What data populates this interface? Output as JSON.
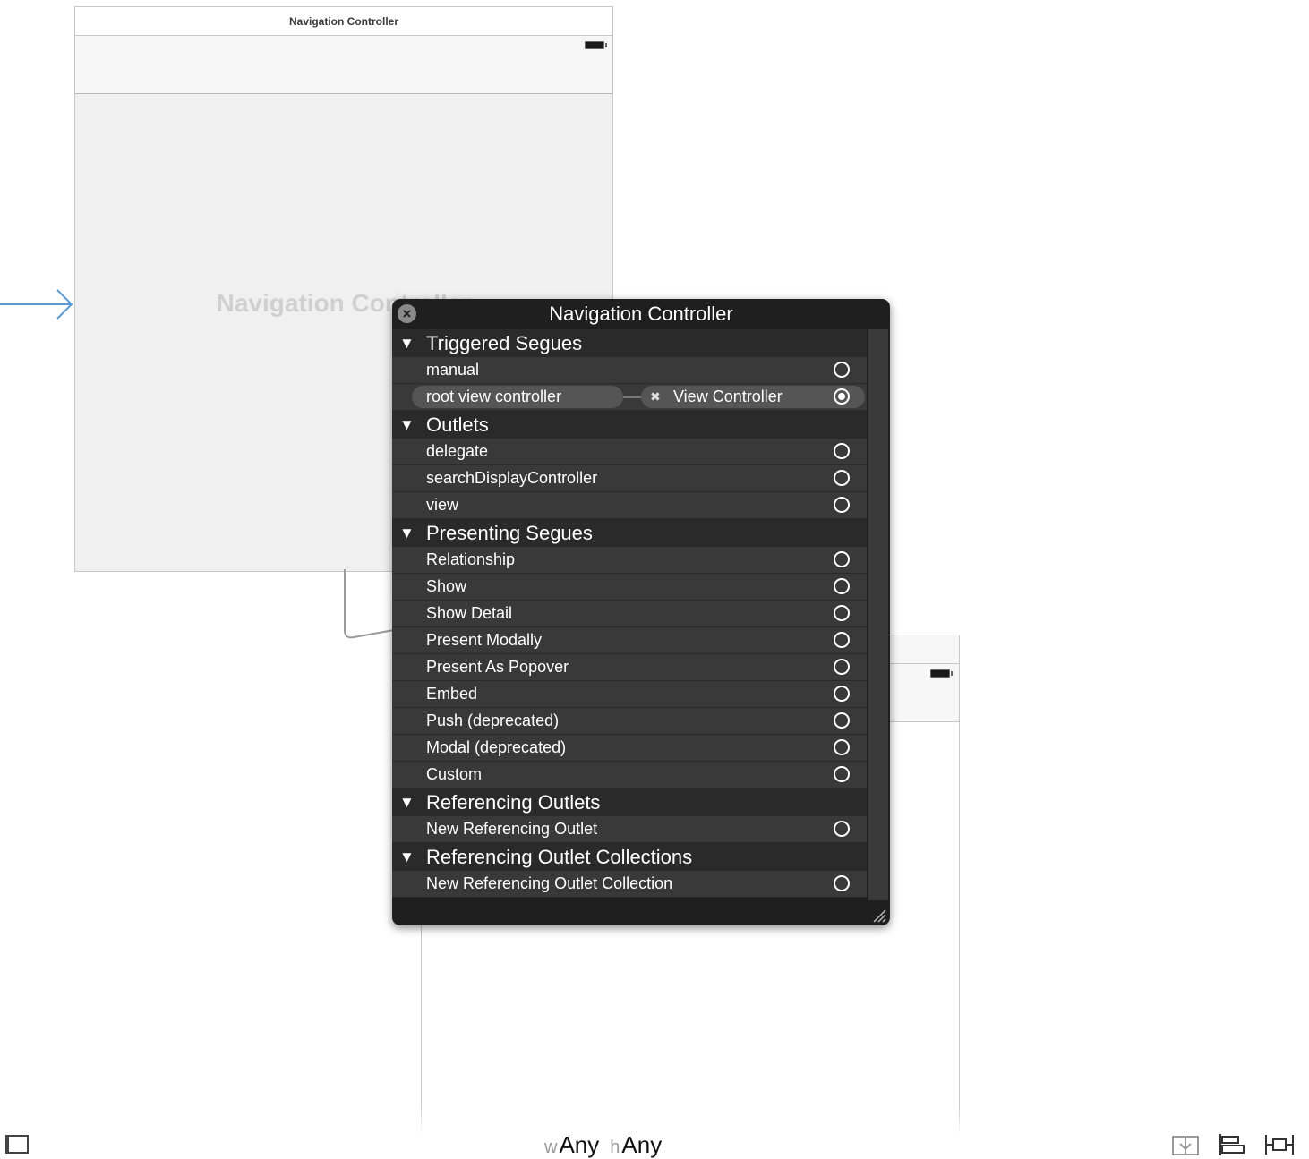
{
  "canvas": {
    "nav_scene": {
      "title": "Navigation Controller",
      "placeholder": "Navigation Controller"
    }
  },
  "hud": {
    "title": "Navigation Controller",
    "close_icon": "close-icon",
    "sections": [
      {
        "label": "Triggered Segues",
        "rows": [
          {
            "label": "manual"
          },
          {
            "label": "root view controller",
            "target": "View Controller",
            "connected": true
          }
        ]
      },
      {
        "label": "Outlets",
        "rows": [
          {
            "label": "delegate"
          },
          {
            "label": "searchDisplayController"
          },
          {
            "label": "view"
          }
        ]
      },
      {
        "label": "Presenting Segues",
        "rows": [
          {
            "label": "Relationship"
          },
          {
            "label": "Show"
          },
          {
            "label": "Show Detail"
          },
          {
            "label": "Present Modally"
          },
          {
            "label": "Present As Popover"
          },
          {
            "label": "Embed"
          },
          {
            "label": "Push (deprecated)"
          },
          {
            "label": "Modal (deprecated)"
          },
          {
            "label": "Custom"
          }
        ]
      },
      {
        "label": "Referencing Outlets",
        "rows": [
          {
            "label": "New Referencing Outlet"
          }
        ]
      },
      {
        "label": "Referencing Outlet Collections",
        "rows": [
          {
            "label": "New Referencing Outlet Collection"
          }
        ]
      }
    ]
  },
  "bottom_bar": {
    "width_prefix": "w",
    "width_value": "Any",
    "height_prefix": "h",
    "height_value": "Any"
  },
  "colors": {
    "hud_bg": "#1f1f1f",
    "row_bg": "#393939",
    "entry_arrow": "#5b9bd5"
  }
}
